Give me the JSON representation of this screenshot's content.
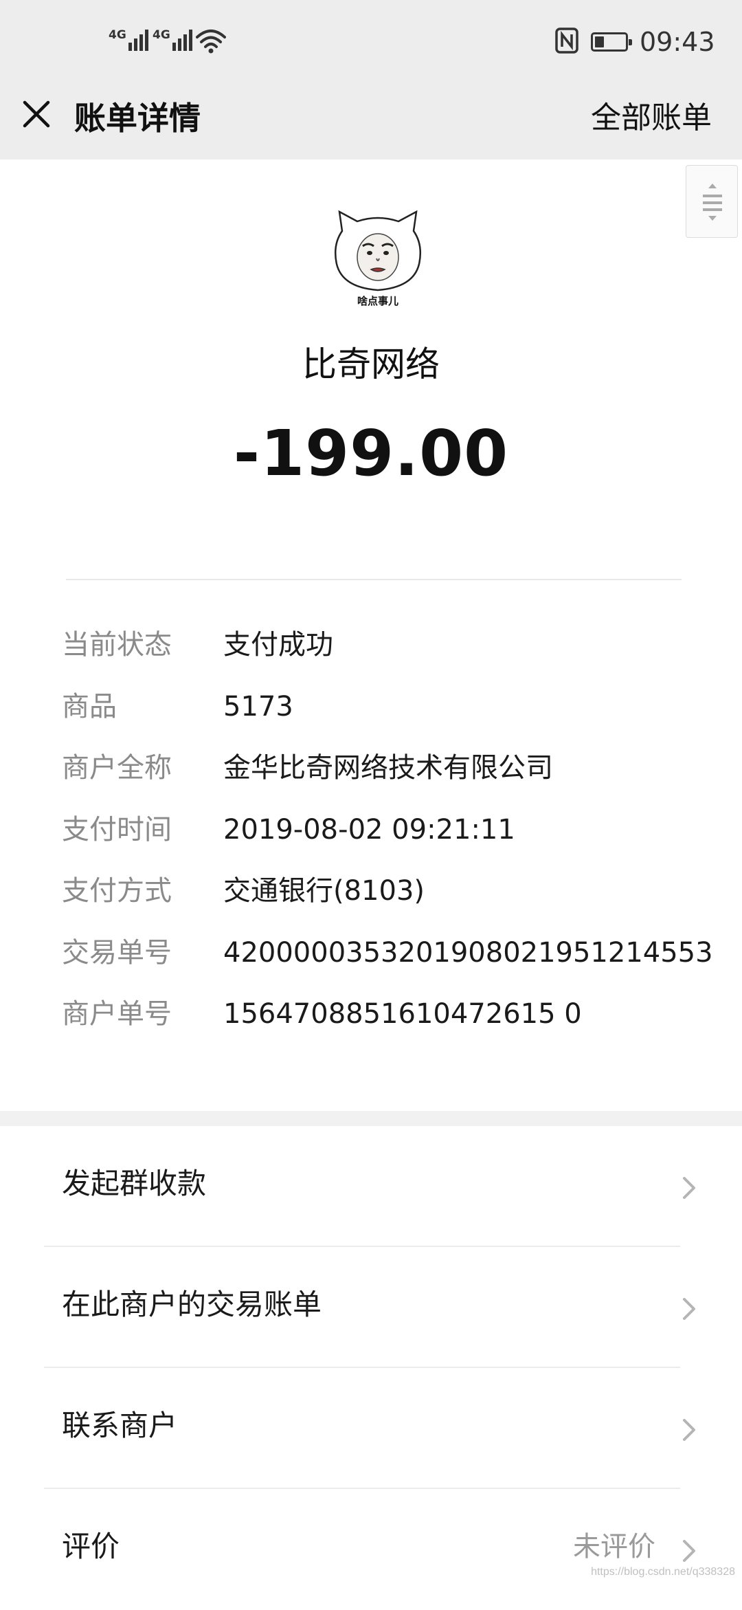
{
  "status_bar": {
    "network_1": "4G",
    "network_2": "4G",
    "time": "09:43",
    "battery_level": 0.3
  },
  "header": {
    "title": "账单详情",
    "right_action": "全部账单"
  },
  "merchant": {
    "avatar_caption": "啥点事儿",
    "name": "比奇网络",
    "amount": "-199.00"
  },
  "details": [
    {
      "label": "当前状态",
      "value": "支付成功"
    },
    {
      "label": "商品",
      "value": "5173"
    },
    {
      "label": "商户全称",
      "value": "金华比奇网络技术有限公司"
    },
    {
      "label": "支付时间",
      "value": "2019-08-02 09:21:11"
    },
    {
      "label": "支付方式",
      "value": "交通银行(8103)"
    },
    {
      "label": "交易单号",
      "value": "4200000353201908021951214553"
    },
    {
      "label": "商户单号",
      "value": "1564708851610472615 0"
    }
  ],
  "actions": [
    {
      "label": "发起群收款",
      "extra": ""
    },
    {
      "label": "在此商户的交易账单",
      "extra": ""
    },
    {
      "label": "联系商户",
      "extra": ""
    },
    {
      "label": "评价",
      "extra": "未评价"
    }
  ],
  "watermark": "https://blog.csdn.net/q338328"
}
